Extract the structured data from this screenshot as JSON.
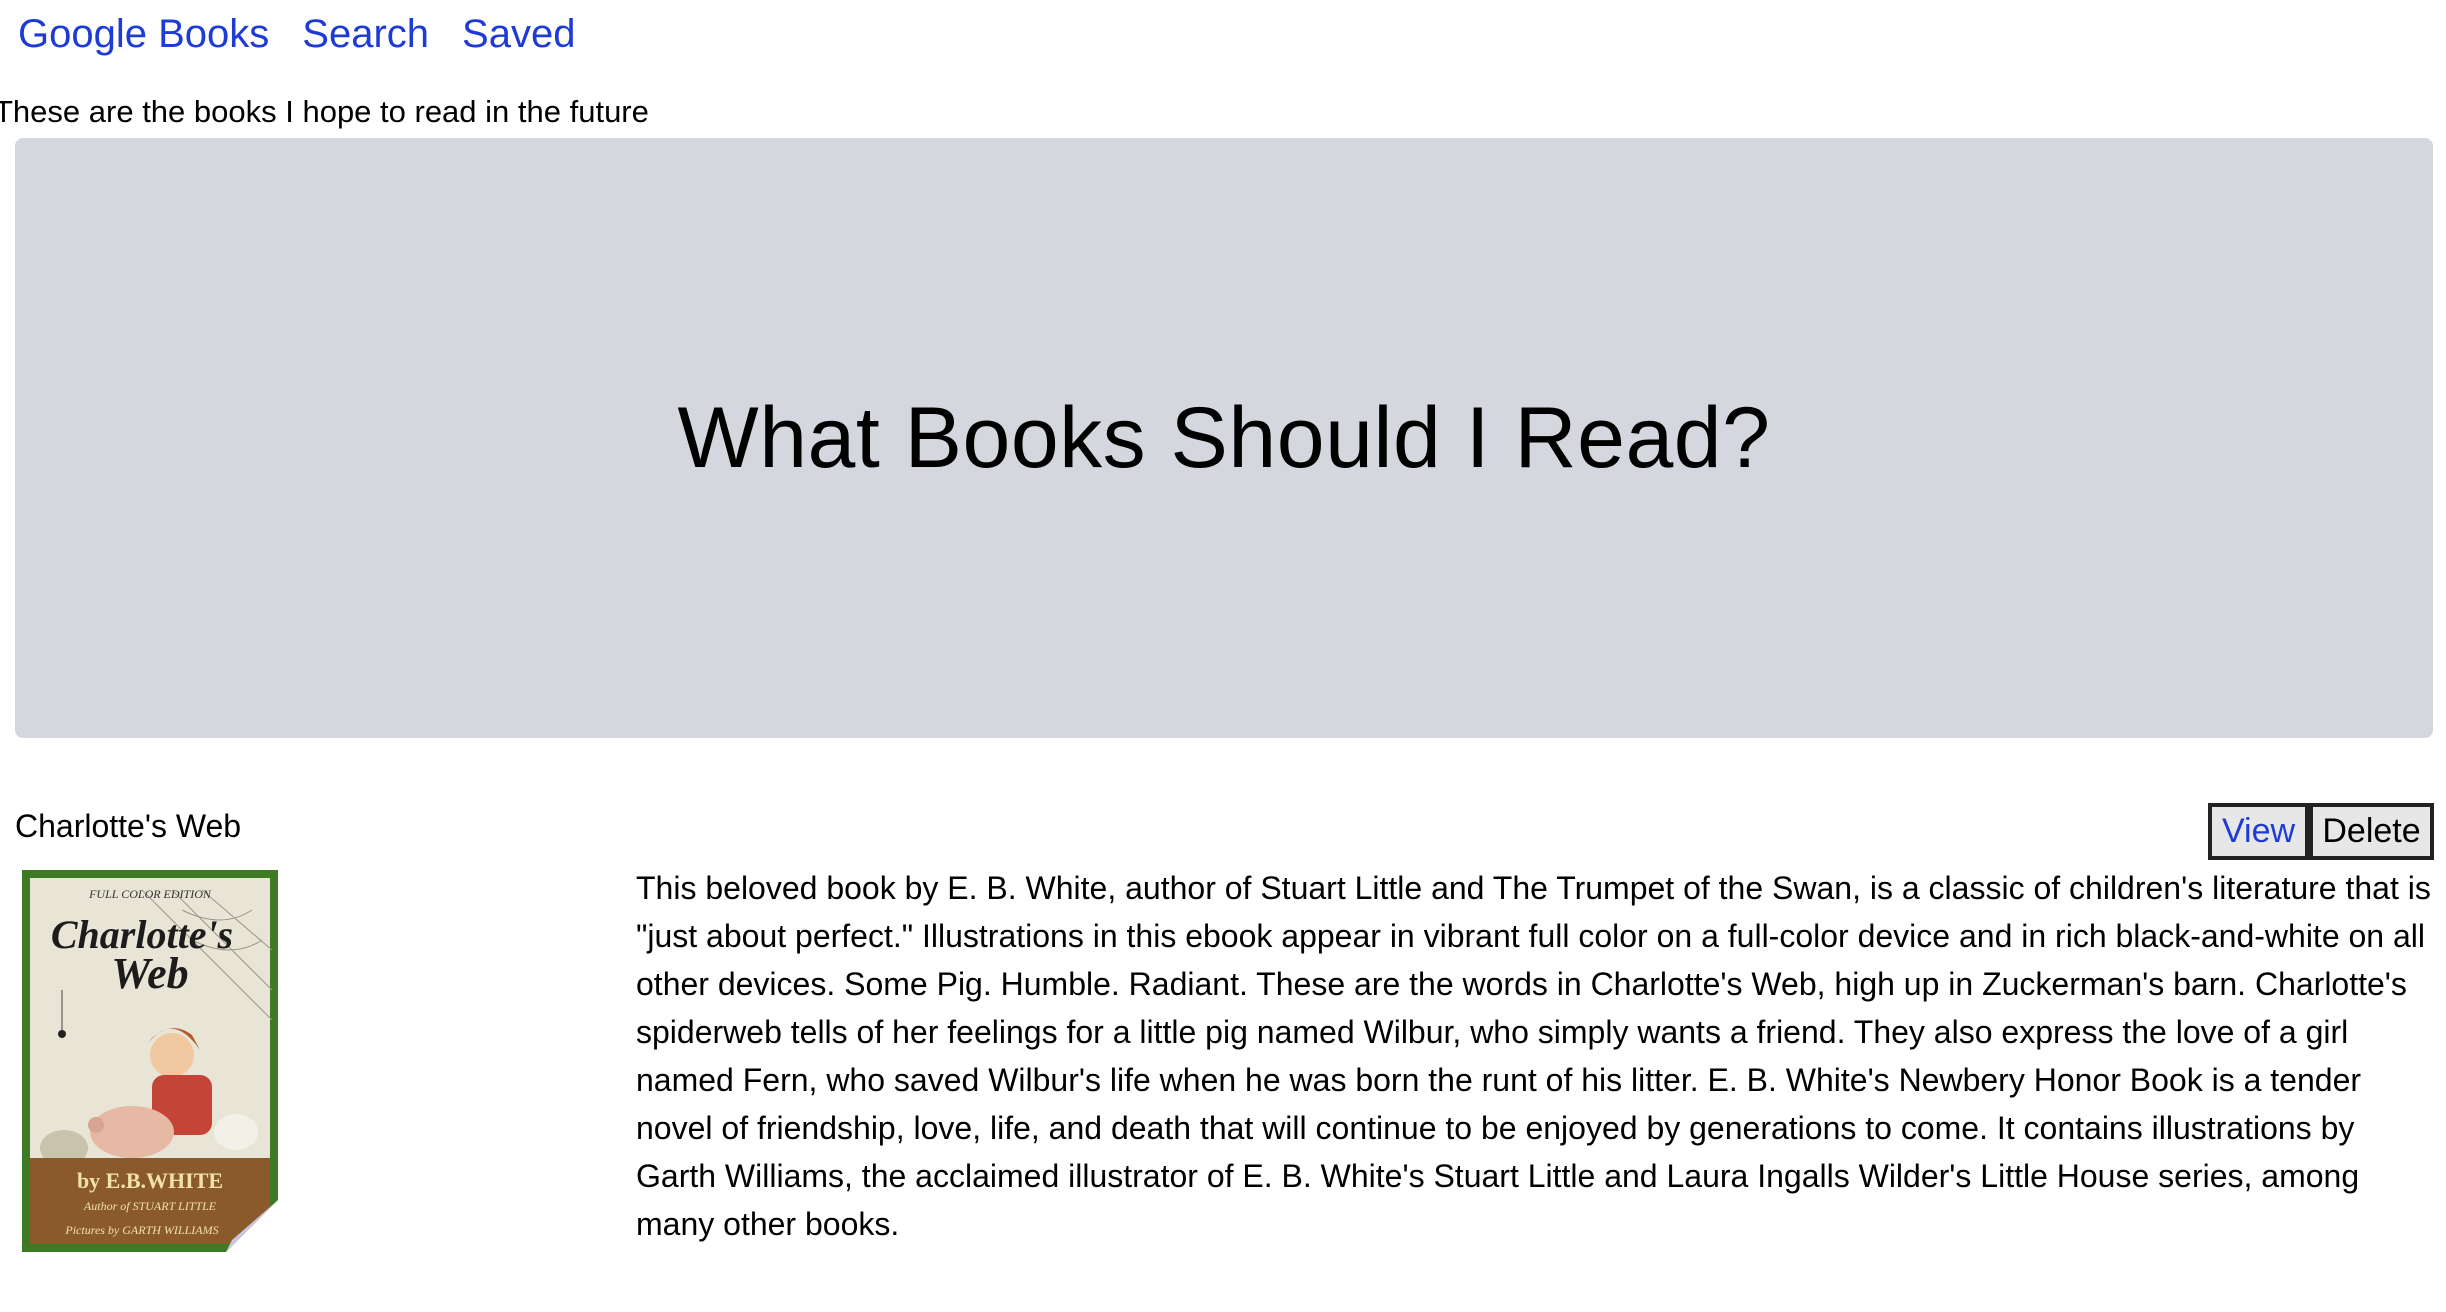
{
  "nav": {
    "google_books": "Google Books",
    "search": "Search",
    "saved": "Saved"
  },
  "tagline": "These are the books I hope to read in the future",
  "hero": {
    "title": "What Books Should I Read?"
  },
  "book": {
    "title": "Charlotte's Web",
    "view_label": "View",
    "delete_label": "Delete",
    "cover": {
      "edition": "FULL COLOR EDITION",
      "title_line1": "Charlotte's",
      "title_line2": "Web",
      "author_line": "by E.B.WHITE",
      "author_sub": "Author of STUART LITTLE",
      "illustrator": "Pictures by GARTH WILLIAMS"
    },
    "description_lines": [
      "This beloved book by E. B. White, author of Stuart Little and The Trumpet of the Swan, is a classic of children's literature that is",
      "\"just about perfect.\" Illustrations in this ebook appear in vibrant full color on a full-color device and in rich black-and-white on all",
      "other devices. Some Pig. Humble. Radiant. These are the words in Charlotte's Web, high up in Zuckerman's barn. Charlotte's",
      "spiderweb tells of her feelings for a little pig named Wilbur, who simply wants a friend. They also express the love of a girl",
      "named Fern, who saved Wilbur's life when he was born the runt of his litter. E. B. White's Newbery Honor Book is a tender",
      "novel of friendship, love, life, and death that will continue to be enjoyed by generations to come. It contains illustrations by",
      "Garth Williams, the acclaimed illustrator of E. B. White's Stuart Little and Laura Ingalls Wilder's Little House series, among",
      "many other books."
    ]
  },
  "colors": {
    "link": "#1f3bd6",
    "hero_bg": "#d4d7de",
    "cover_border": "#3e7a24"
  }
}
